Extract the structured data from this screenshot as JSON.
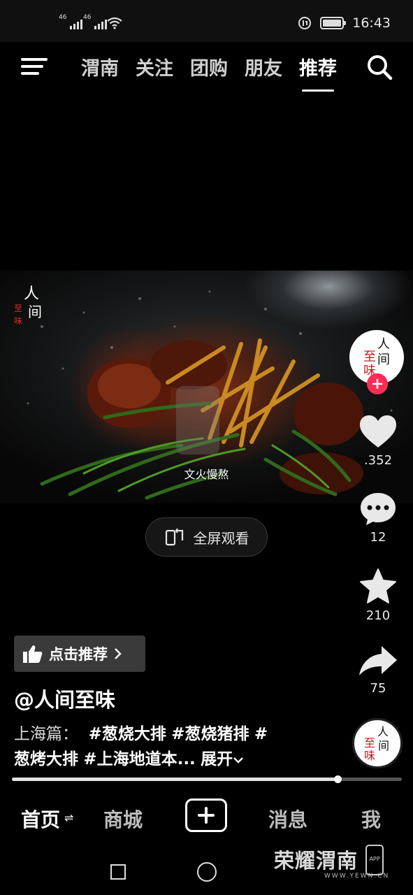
{
  "status_bar": {
    "sim1": "46",
    "sim2": "46",
    "time": "16:43"
  },
  "top_nav": {
    "tabs": [
      {
        "label": "渭南",
        "active": false
      },
      {
        "label": "关注",
        "active": false
      },
      {
        "label": "团购",
        "active": false
      },
      {
        "label": "朋友",
        "active": false
      },
      {
        "label": "推荐",
        "active": true
      }
    ]
  },
  "video": {
    "watermark": "人间至味",
    "caption": "文火慢熬",
    "fullscreen_label": "全屏观看"
  },
  "right_rail": {
    "avatar_text": "人间至味",
    "likes": ".352",
    "comments": "12",
    "favorites": "210",
    "shares": "75"
  },
  "info": {
    "recommend_label": "点击推荐",
    "author": "@人间至味",
    "desc_lead": "上海篇：",
    "tags_line1": [
      "#葱烧大排",
      "#葱烧猪排",
      "#"
    ],
    "tags_line2": [
      "葱烤大排",
      "#上海地道本..."
    ],
    "expand_label": "展开",
    "progress": 0.835
  },
  "tabbar": {
    "home": "首页",
    "mall": "商城",
    "messages": "消息",
    "me": "我"
  },
  "brand": {
    "name": "荣耀渭南",
    "url": "WWW.YEWN.CN",
    "app": "APP"
  },
  "colors": {
    "accent_red": "#fe2c55",
    "background": "#000000"
  }
}
